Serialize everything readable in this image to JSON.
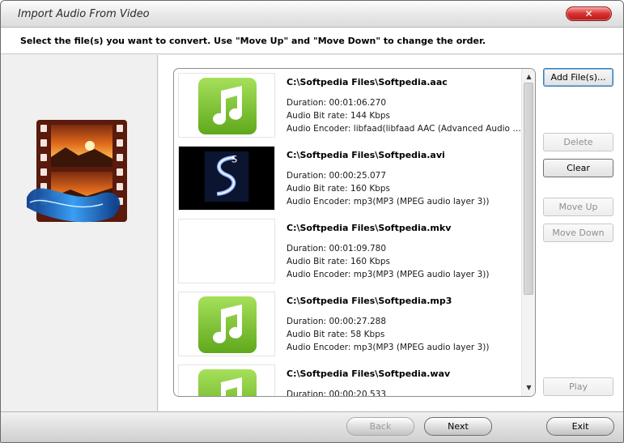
{
  "window": {
    "title": "Import Audio From Video",
    "close_label": "✕"
  },
  "instruction": "Select the file(s) you want to convert. Use \"Move Up\" and \"Move Down\" to change the order.",
  "files": [
    {
      "name": "C:\\Softpedia Files\\Softpedia.aac",
      "thumbnail": "music-note-icon",
      "duration": "Duration: 00:01:06.270",
      "bitrate": "Audio Bit rate: 144 Kbps",
      "encoder": "Audio Encoder: libfaad(libfaad AAC (Advanced Audio C..."
    },
    {
      "name": "C:\\Softpedia Files\\Softpedia.avi",
      "thumbnail": "video-frame",
      "duration": "Duration: 00:00:25.077",
      "bitrate": "Audio Bit rate: 160 Kbps",
      "encoder": "Audio Encoder: mp3(MP3 (MPEG audio layer 3))"
    },
    {
      "name": "C:\\Softpedia Files\\Softpedia.mkv",
      "thumbnail": "blank",
      "duration": "Duration: 00:01:09.780",
      "bitrate": "Audio Bit rate: 160 Kbps",
      "encoder": "Audio Encoder: mp3(MP3 (MPEG audio layer 3))"
    },
    {
      "name": "C:\\Softpedia Files\\Softpedia.mp3",
      "thumbnail": "music-note-icon",
      "duration": "Duration: 00:00:27.288",
      "bitrate": "Audio Bit rate: 58 Kbps",
      "encoder": "Audio Encoder: mp3(MP3 (MPEG audio layer 3))"
    },
    {
      "name": "C:\\Softpedia Files\\Softpedia.wav",
      "thumbnail": "music-note-icon",
      "duration": "Duration: 00:00:20.533",
      "bitrate": "",
      "encoder": ""
    }
  ],
  "buttons": {
    "add_files": "Add File(s)...",
    "delete": "Delete",
    "clear": "Clear",
    "move_up": "Move Up",
    "move_down": "Move Down",
    "play": "Play"
  },
  "footer": {
    "back": "Back",
    "next": "Next",
    "exit": "Exit"
  },
  "colors": {
    "note_green": "#7dc82a",
    "close_red": "#d93030"
  }
}
